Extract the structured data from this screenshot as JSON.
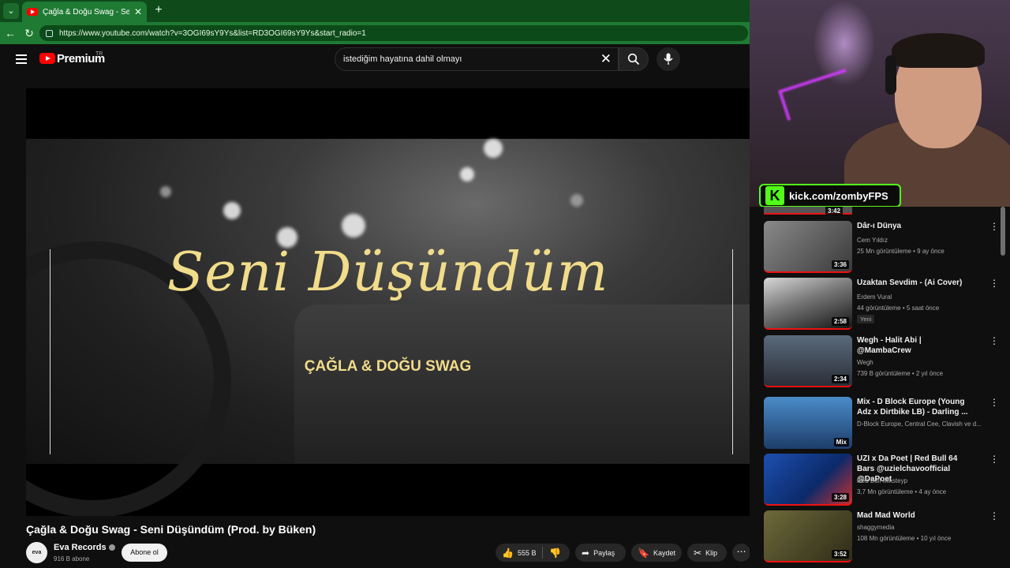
{
  "browser": {
    "tab_title": "Çağla & Doğu Swag - Seni Düşündüm",
    "url": "https://www.youtube.com/watch?v=3OGI69sY9Ys&list=RD3OGI69sY9Ys&start_radio=1"
  },
  "masthead": {
    "brand": "Premium",
    "region": "TR",
    "search_query": "istediğim hayatına dahil olmayı"
  },
  "player": {
    "art_title": "Seni Düşündüm",
    "art_artists": "ÇAĞLA & DOĞU SWAG"
  },
  "video": {
    "title": "Çağla & Doğu Swag - Seni Düşündüm (Prod. by Büken)",
    "channel": "Eva Records",
    "avatar_text": "eva",
    "subscribers": "916 B abone",
    "subscribe_label": "Abone ol",
    "likes": "555 B",
    "share_label": "Paylaş",
    "save_label": "Kaydet",
    "clip_label": "Klip"
  },
  "overlay": {
    "kick_text": "kick.com/zombyFPS"
  },
  "sidebar": {
    "partial_duration": "3:42",
    "items": [
      {
        "title": "Dâr-ı Dünya",
        "channel": "Cem Yıldız",
        "meta": "25 Mn görüntüleme • 9 ay önce",
        "duration": "3:36",
        "badge": ""
      },
      {
        "title": "Uzaktan Sevdim - (Ai Cover)",
        "channel": "Erdem Vural",
        "meta": "44 görüntüleme • 5 saat önce",
        "duration": "2:58",
        "badge": "Yeni"
      },
      {
        "title": "Wegh - Halit Abi | @MambaCrew",
        "channel": "Wegh",
        "meta": "739 B görüntüleme • 2 yıl önce",
        "duration": "2:34",
        "badge": ""
      },
      {
        "title": "Mix - D Block Europe (Young Adz x Dirtbike LB) - Darling ...",
        "channel": "D-Block Europe, Central Cee, Clavish ve d...",
        "meta": "",
        "duration": "Mix",
        "badge": ""
      },
      {
        "title": "UZI x Da Poet | Red Bull 64 Bars @uzielchavoofficial @DaPoet",
        "channel": "Red Bull Mikstеyp",
        "meta": "3,7 Mn görüntüleme • 4 ay önce",
        "duration": "3:28",
        "badge": ""
      },
      {
        "title": "Mad Mad World",
        "channel": "shaggymedia",
        "meta": "108 Mn görüntüleme • 10 yıl önce",
        "duration": "3:52",
        "badge": ""
      }
    ]
  },
  "colors": {
    "chrome_green": "#1f7a33",
    "yt_red": "#ff0000",
    "kick_green": "#53fc18",
    "art_gold": "#f0dc8a"
  }
}
